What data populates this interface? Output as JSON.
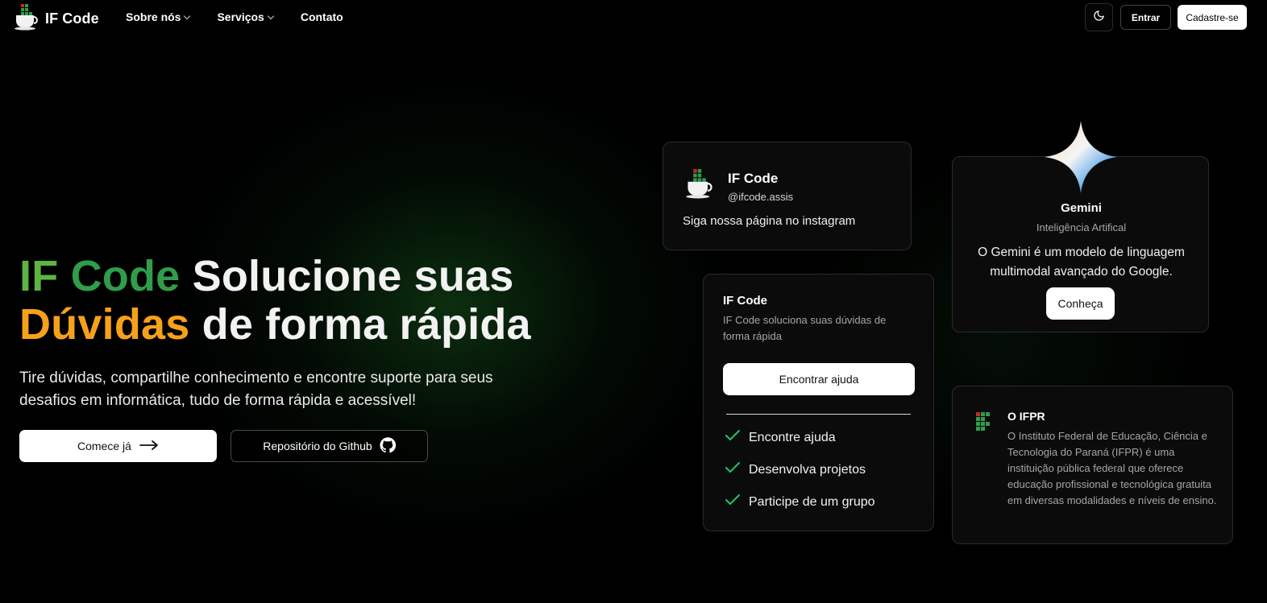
{
  "nav": {
    "brand": "IF Code",
    "links": [
      {
        "label": "Sobre nós",
        "has_dropdown": true
      },
      {
        "label": "Serviços",
        "has_dropdown": true
      },
      {
        "label": "Contato",
        "has_dropdown": false
      }
    ],
    "theme_toggle_icon": "moon-icon",
    "login_label": "Entrar",
    "signup_label": "Cadastre-se"
  },
  "hero": {
    "title_part1": "IF",
    "title_part2": "Code",
    "title_part3": "Solucione suas",
    "title_part4": "Dúvidas",
    "title_part5": "de forma rápida",
    "subtitle": "Tire dúvidas, compartilhe conhecimento e encontre suporte para seus desafios em informática, tudo de forma rápida e acessível!",
    "cta_primary": "Comece já",
    "cta_secondary": "Repositório do Github",
    "colors": {
      "if": "#5db43f",
      "code": "#2f9d4a",
      "duvidas": "#f6a11a"
    }
  },
  "instagram_card": {
    "name": "IF Code",
    "handle": "@ifcode.assis",
    "description": "Siga nossa página no instagram"
  },
  "main_card": {
    "title": "IF Code",
    "description": "IF Code soluciona suas dúvidas de forma rápida",
    "button": "Encontrar ajuda",
    "features": [
      "Encontre ajuda",
      "Desenvolva projetos",
      "Participe de um grupo"
    ],
    "check_color": "#22c55e"
  },
  "gemini_card": {
    "title": "Gemini",
    "subtitle": "Inteligência Artifical",
    "description": "O Gemini é um modelo de linguagem multimodal avançado do Google.",
    "button": "Conheça"
  },
  "ifpr_card": {
    "title": "O IFPR",
    "description": "O Instituto Federal de Educação, Ciência e Tecnologia do Paraná (IFPR) é uma instituição pública federal que oferece educação profissional e tecnológica gratuita em diversas modalidades e níveis de ensino."
  }
}
